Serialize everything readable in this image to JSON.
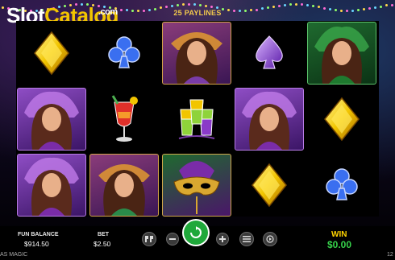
{
  "watermark": {
    "slot": "Slot",
    "catalog": "Catalog",
    "com": ".com"
  },
  "header": {
    "paylines": "25 PAYLINES"
  },
  "reels": [
    [
      "diamond",
      "mardi-gras-lady",
      "purple-lady",
      "purple-lady"
    ],
    [
      "club",
      "cocktail",
      "carnival-lady"
    ],
    [
      "carnival-lady",
      "shot-glasses",
      "mardi-gras-mask"
    ],
    [
      "spade",
      "purple-lady",
      "diamond"
    ],
    [
      "green-lady",
      "diamond",
      "club"
    ]
  ],
  "footer": {
    "balance_label": "FUN BALANCE",
    "balance_value": "$914.50",
    "bet_label": "BET",
    "bet_value": "$2.50",
    "win_label": "WIN",
    "win_value": "$0.00",
    "game_name_fragment": "AS MAGIC",
    "corner_fragment": "12"
  },
  "colors": {
    "accent_gold": "#f2c94c",
    "win_green": "#36d04a",
    "spin_green": "#1fa83a"
  }
}
